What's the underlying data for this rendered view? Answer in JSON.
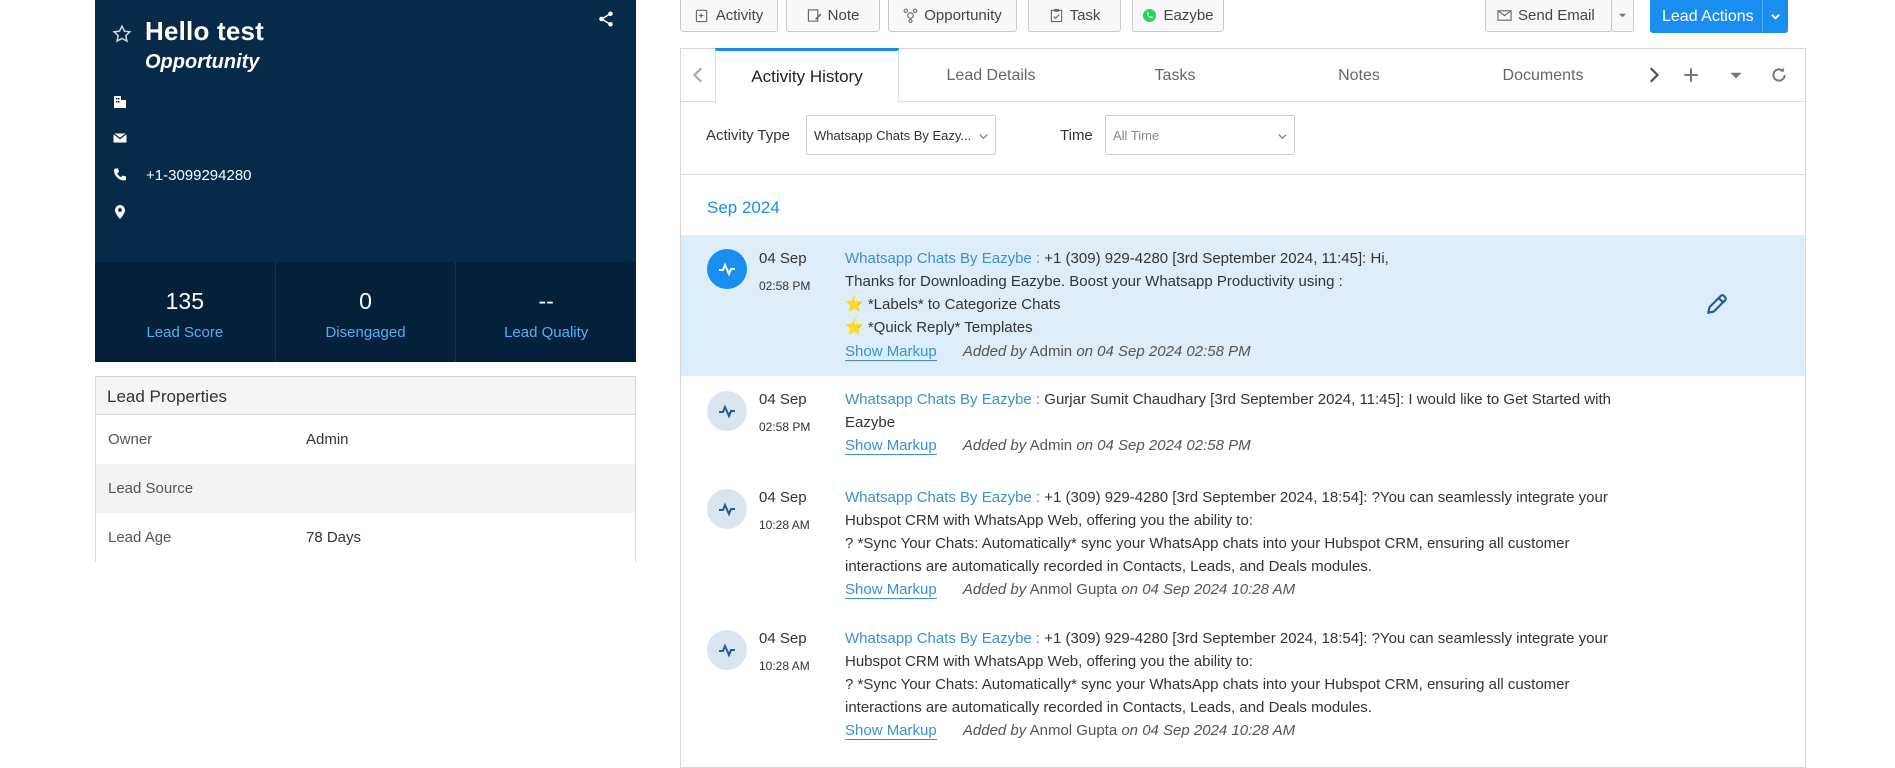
{
  "profile": {
    "name": "Hello test",
    "stage": "Opportunity",
    "company": "",
    "email": "",
    "phone": "+1-3099294280",
    "location": "",
    "stats": [
      {
        "value": "135",
        "label": "Lead Score"
      },
      {
        "value": "0",
        "label": "Disengaged"
      },
      {
        "value": "--",
        "label": "Lead Quality"
      }
    ]
  },
  "lead_properties": {
    "title": "Lead Properties",
    "rows": [
      {
        "key": "Owner",
        "value": "Admin"
      },
      {
        "key": "Lead Source",
        "value": ""
      },
      {
        "key": "Lead Age",
        "value": "78 Days"
      }
    ]
  },
  "toolbar": {
    "activity": "Activity",
    "note": "Note",
    "opportunity": "Opportunity",
    "task": "Task",
    "eazybe": "Eazybe",
    "send_email": "Send Email",
    "lead_actions": "Lead Actions"
  },
  "tabs": [
    "Activity History",
    "Lead Details",
    "Tasks",
    "Notes",
    "Documents"
  ],
  "active_tab": "Activity History",
  "filters": {
    "activity_type_label": "Activity Type",
    "activity_type_value": "Whatsapp Chats By Eazy...",
    "time_label": "Time",
    "time_value": "All Time"
  },
  "month": "Sep 2024",
  "activities": [
    {
      "date": "04 Sep",
      "time": "02:58 PM",
      "type": "Whatsapp Chats By Eazybe :",
      "lines": [
        "+1 (309) 929-4280 [3rd September 2024, 11:45]: Hi,",
        "Thanks for Downloading Eazybe. Boost your Whatsapp Productivity using :",
        "⭐ *Labels* to Categorize Chats",
        "⭐ *Quick Reply* Templates"
      ],
      "show_markup": "Show Markup",
      "added_by_prefix": "Added by",
      "added_by": "Admin",
      "added_on": "on 04 Sep 2024 02:58 PM"
    },
    {
      "date": "04 Sep",
      "time": "02:58 PM",
      "type": "Whatsapp Chats By Eazybe :",
      "lines": [
        "Gurjar Sumit Chaudhary [3rd September 2024, 11:45]: I would like to Get Started with",
        "Eazybe"
      ],
      "show_markup": "Show Markup",
      "added_by_prefix": "Added by",
      "added_by": "Admin",
      "added_on": "on 04 Sep 2024 02:58 PM"
    },
    {
      "date": "04 Sep",
      "time": "10:28 AM",
      "type": "Whatsapp Chats By Eazybe :",
      "lines": [
        "+1 (309) 929-4280 [3rd September 2024, 18:54]: ?You can seamlessly integrate your",
        "Hubspot CRM with WhatsApp Web, offering you the ability to:",
        "? *Sync Your Chats: Automatically* sync your WhatsApp chats into your Hubspot CRM, ensuring all customer",
        "interactions are automatically recorded in Contacts, Leads, and Deals modules."
      ],
      "show_markup": "Show Markup",
      "added_by_prefix": "Added by",
      "added_by": "Anmol Gupta",
      "added_on": "on 04 Sep 2024 10:28 AM"
    },
    {
      "date": "04 Sep",
      "time": "10:28 AM",
      "type": "Whatsapp Chats By Eazybe :",
      "lines": [
        "+1 (309) 929-4280 [3rd September 2024, 18:54]: ?You can seamlessly integrate your",
        "Hubspot CRM with WhatsApp Web, offering you the ability to:",
        "? *Sync Your Chats: Automatically* sync your WhatsApp chats into your Hubspot CRM, ensuring all customer",
        "interactions are automatically recorded in Contacts, Leads, and Deals modules."
      ],
      "show_markup": "Show Markup",
      "added_by_prefix": "Added by",
      "added_by": "Anmol Gupta",
      "added_on": "on 04 Sep 2024 10:28 AM"
    }
  ],
  "colors": {
    "card_bg": "#062a48",
    "stats_bg": "#04203a",
    "accent": "#1a8ef0",
    "link": "#3a8fd8",
    "highlight_row": "#ddeefa"
  }
}
